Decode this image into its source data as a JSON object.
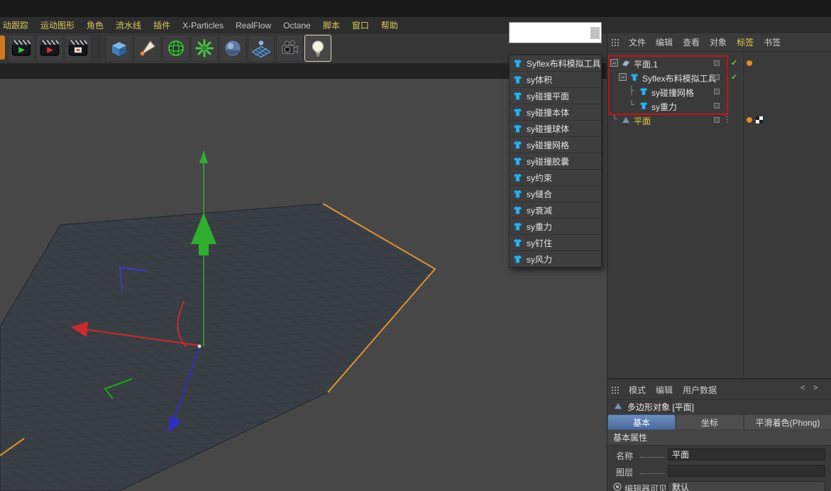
{
  "top_menu": {
    "items": [
      "动跟踪",
      "运动图形",
      "角色",
      "流水线",
      "插件",
      "X-Particles",
      "RealFlow",
      "Octane",
      "脚本",
      "窗口",
      "帮助"
    ]
  },
  "toolbar": {
    "icons": [
      "render-view",
      "render-to-picture-viewer",
      "render-settings",
      "add-cube",
      "pen-tool",
      "subdivision-surface",
      "mograph",
      "sphere",
      "floor",
      "camera",
      "light"
    ]
  },
  "dropdown": {
    "search_value": "",
    "items": [
      "Syflex布料模拟工具",
      "sy体积",
      "sy碰撞平面",
      "sy碰撞本体",
      "sy碰撞球体",
      "sy碰撞网格",
      "sy碰撞胶囊",
      "sy约束",
      "sy缝合",
      "sy衰减",
      "sy重力",
      "sy钉住",
      "sy风力"
    ]
  },
  "object_manager": {
    "menu_items": [
      "文件",
      "编辑",
      "查看",
      "对象",
      "标签",
      "书签"
    ],
    "rows": [
      {
        "label": "平面.1"
      },
      {
        "label": "Syflex布料模拟工具"
      },
      {
        "label": "sy碰撞网格"
      },
      {
        "label": "sy重力"
      },
      {
        "label": "平面"
      }
    ]
  },
  "attribute_manager": {
    "menu_items": [
      "模式",
      "编辑",
      "用户数据"
    ],
    "object_title": "多边形对象 [平面]",
    "tabs": [
      "基本",
      "坐标",
      "平滑着色(Phong)"
    ],
    "active_tab": "基本",
    "section_title": "基本属性",
    "name_label": "名称",
    "name_value": "平面",
    "layer_label": "图层",
    "layer_value": "",
    "visible_label": "编辑器可见",
    "visible_value": "默认"
  },
  "icons": {
    "check": "✓",
    "vertical_dots": "⋮",
    "collapse": "−",
    "tree_branch": "├",
    "tree_end": "└",
    "chevron_left": "<",
    "chevron_right": ">"
  },
  "colors": {
    "selection_red": "#c41111",
    "plane_selected_orange": "#e0912f",
    "axis_x_red": "#c82b2b",
    "axis_y_green": "#2fae2f",
    "axis_z_blue": "#2d2dc8",
    "syflex_blue": "#35aee8",
    "active_tab_blue": "#49699a",
    "menu_yellow": "#d6c95e"
  }
}
